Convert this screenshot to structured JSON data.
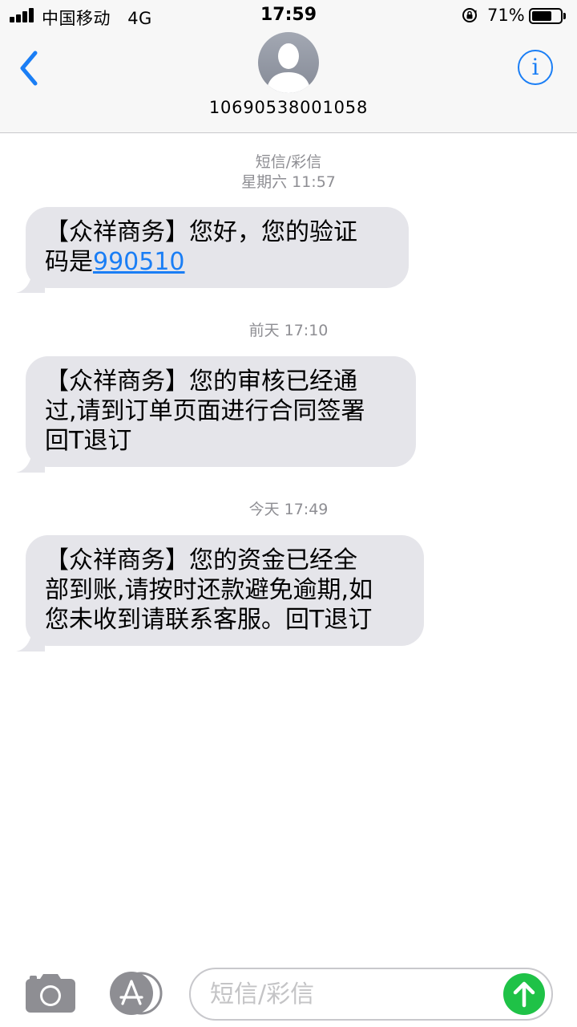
{
  "status_bar": {
    "carrier": "中国移动",
    "network": "4G",
    "time": "17:59",
    "battery_percent": "71%",
    "battery_level": 0.71
  },
  "header": {
    "contact_number": "10690538001058",
    "info_glyph": "i",
    "back_icon": "chevron-left-icon",
    "info_icon": "info-circle-icon",
    "avatar_icon": "person-silhouette-icon"
  },
  "conversation": {
    "service_label": "短信/彩信",
    "messages": [
      {
        "timestamp": "星期六 11:57",
        "text_before_link": "【众祥商务】您好，您的验证码是",
        "link": "990510",
        "line1": "【众祥商务】您好，您的验证",
        "line2_prefix": "码是"
      },
      {
        "timestamp": "前天 17:10",
        "line1": "【众祥商务】您的审核已经通",
        "line2": "过,请到订单页面进行合同签署",
        "line3": "回T退订"
      },
      {
        "timestamp": "今天 17:49",
        "line1": "【众祥商务】您的资金已经全",
        "line2": "部到账,请按时还款避免逾期,如",
        "line3": "您未收到请联系客服。回T退订"
      }
    ]
  },
  "input_bar": {
    "placeholder": "短信/彩信",
    "camera_icon": "camera-icon",
    "appstore_icon": "app-store-icon",
    "send_icon": "arrow-up-icon"
  },
  "colors": {
    "accent_blue": "#1a7ef5",
    "bubble_gray": "#e5e5ea",
    "send_green": "#1fc247",
    "timestamp_gray": "#8e8e93"
  }
}
